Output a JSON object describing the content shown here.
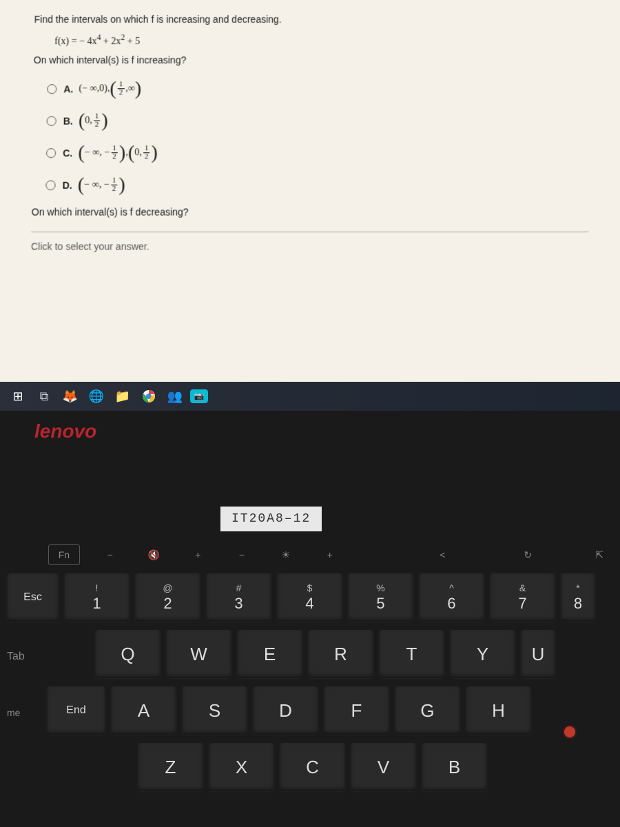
{
  "question": {
    "title": "Find the intervals on which f is increasing and decreasing.",
    "formula_prefix": "f(x) = − 4x",
    "formula_exp1": "4",
    "formula_mid": " + 2x",
    "formula_exp2": "2",
    "formula_suffix": " + 5",
    "sub1": "On which interval(s) is f increasing?",
    "sub2": "On which interval(s) is f decreasing?",
    "prompt": "Click to select your answer."
  },
  "options": {
    "a": {
      "label": "A.",
      "text_pre": "(− ∞,0), ",
      "frac_num": "1",
      "frac_den": "2",
      "text_post": ",∞"
    },
    "b": {
      "label": "B.",
      "text_pre": "0,",
      "frac_num": "1",
      "frac_den": "2"
    },
    "c": {
      "label": "C.",
      "i1_pre": "− ∞, −",
      "i1_num": "1",
      "i1_den": "2",
      "i2_pre": "0,",
      "i2_num": "1",
      "i2_den": "2"
    },
    "d": {
      "label": "D.",
      "text_pre": "− ∞, −",
      "frac_num": "1",
      "frac_den": "2"
    }
  },
  "laptop": {
    "brand": "lenovo",
    "model": "IT20A8–12"
  },
  "fnrow": [
    "Fn",
    "−",
    "🔇",
    "+",
    "−",
    "☀",
    "+",
    "<",
    "↻",
    "⇱"
  ],
  "keys": {
    "row1": [
      {
        "top": "",
        "main": "Esc"
      },
      {
        "top": "!",
        "main": "1"
      },
      {
        "top": "@",
        "main": "2"
      },
      {
        "top": "#",
        "main": "3"
      },
      {
        "top": "$",
        "main": "4"
      },
      {
        "top": "%",
        "main": "5"
      },
      {
        "top": "^",
        "main": "6"
      },
      {
        "top": "&",
        "main": "7"
      },
      {
        "top": "*",
        "main": "8"
      }
    ],
    "row2_prefix": "Tab",
    "row2": [
      "Q",
      "W",
      "E",
      "R",
      "T",
      "Y",
      "U"
    ],
    "row3_prefix": "me",
    "row3_end": "End",
    "row3": [
      "A",
      "S",
      "D",
      "F",
      "G",
      "H"
    ],
    "row4": [
      "Z",
      "X",
      "C",
      "V",
      "B"
    ]
  }
}
